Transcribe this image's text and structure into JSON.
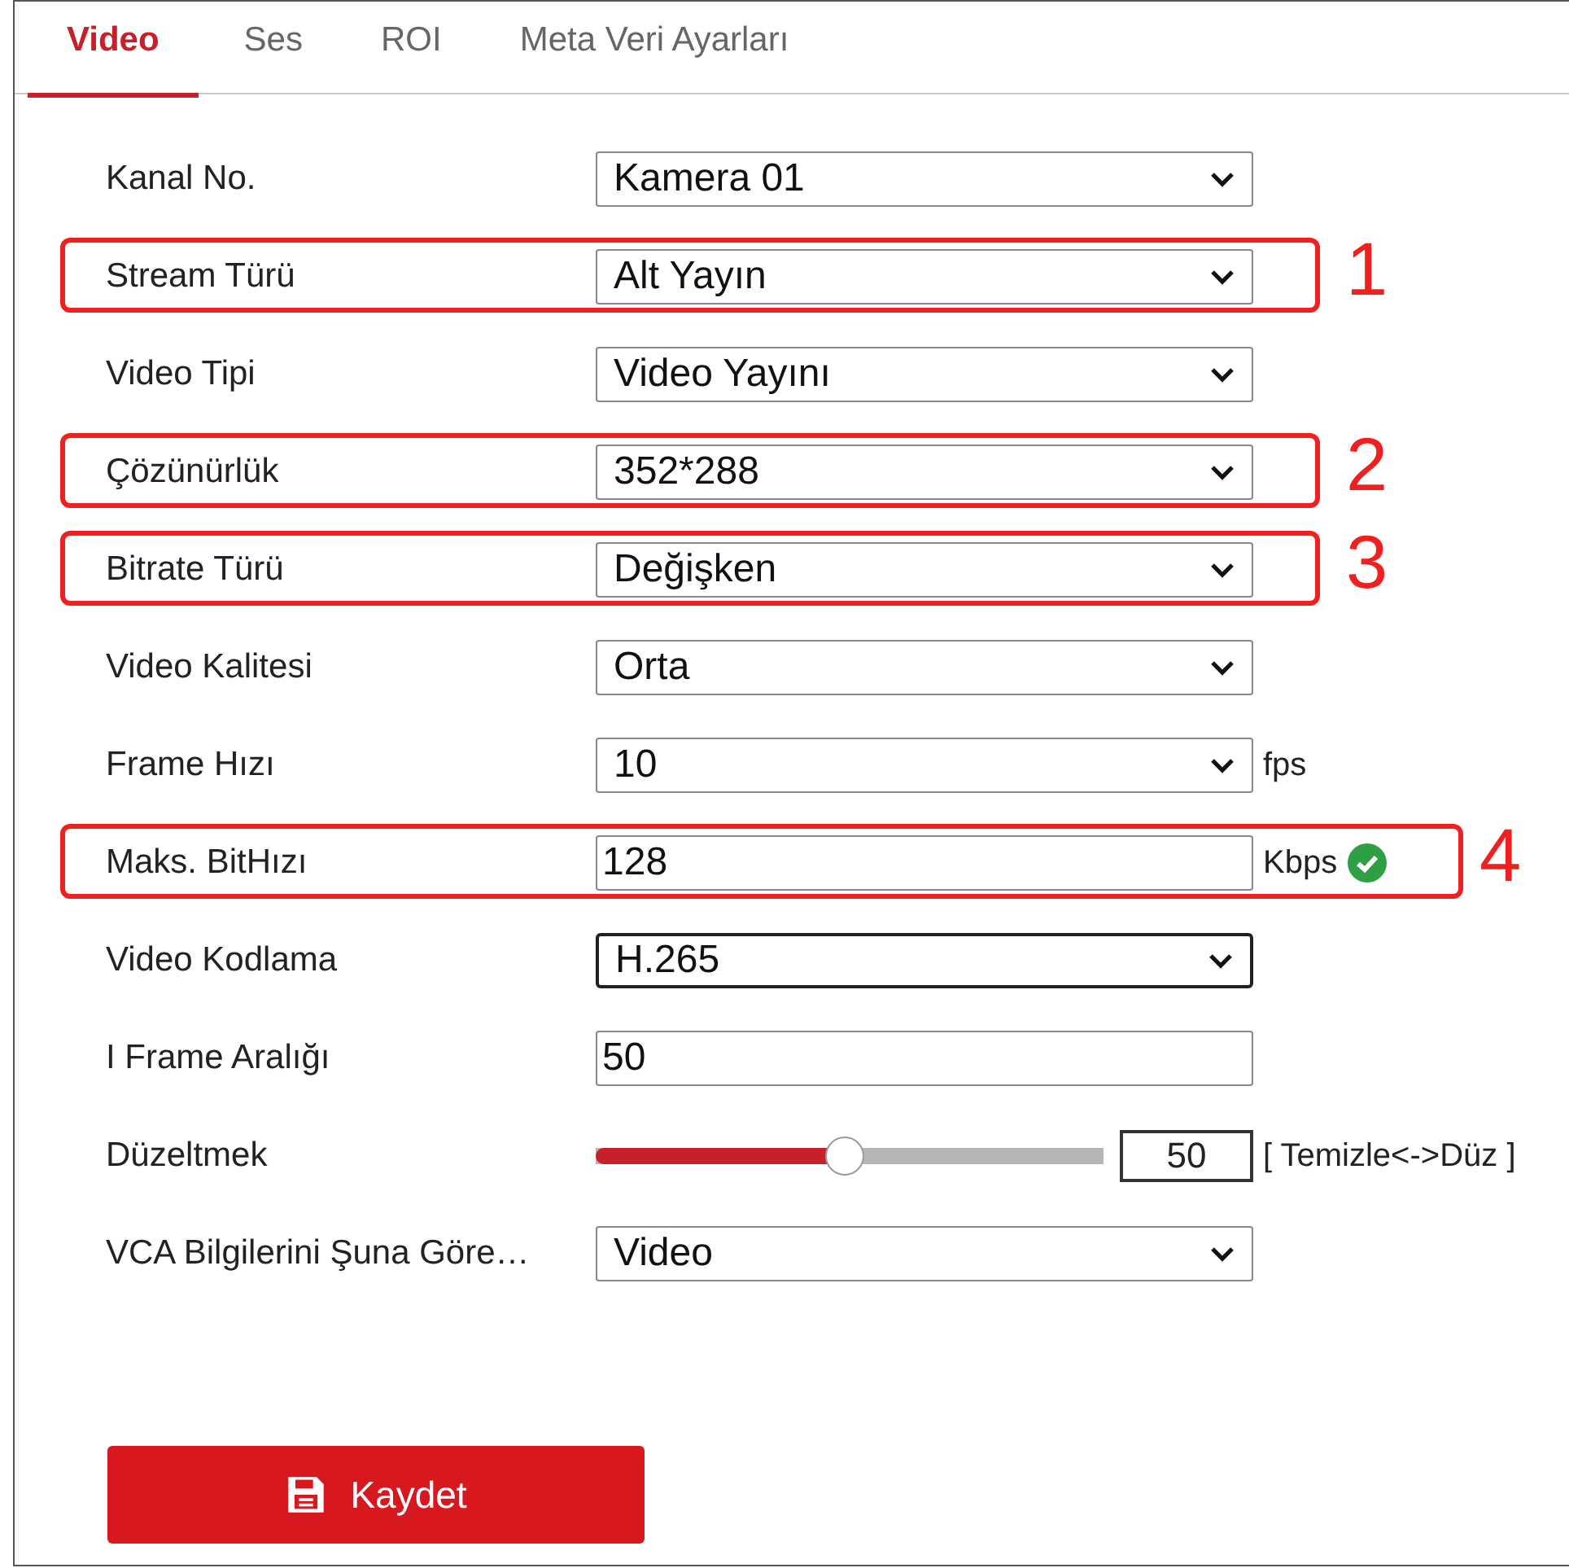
{
  "tabs": [
    {
      "label": "Video",
      "selected": true
    },
    {
      "label": "Ses",
      "selected": false
    },
    {
      "label": "ROI",
      "selected": false
    },
    {
      "label": "Meta Veri Ayarları",
      "selected": false
    }
  ],
  "rows": [
    {
      "kind": "select",
      "label": "Kanal No.",
      "value": "Kamera 01",
      "focused": false
    },
    {
      "kind": "select",
      "label": "Stream Türü",
      "value": "Alt Yayın",
      "focused": false,
      "highlight": "1"
    },
    {
      "kind": "select",
      "label": "Video Tipi",
      "value": "Video Yayını",
      "focused": false
    },
    {
      "kind": "select",
      "label": "Çözünürlük",
      "value": "352*288",
      "focused": false,
      "highlight": "2"
    },
    {
      "kind": "select",
      "label": "Bitrate Türü",
      "value": "Değişken",
      "focused": false,
      "highlight": "3"
    },
    {
      "kind": "select",
      "label": "Video Kalitesi",
      "value": "Orta",
      "focused": false
    },
    {
      "kind": "select",
      "label": "Frame Hızı",
      "value": "10",
      "focused": false,
      "unit": "fps"
    },
    {
      "kind": "input",
      "label": "Maks. BitHızı",
      "value": "128",
      "focused": false,
      "unit": "Kbps",
      "valid": true,
      "highlight": "4"
    },
    {
      "kind": "select",
      "label": "Video Kodlama",
      "value": "H.265",
      "focused": true
    },
    {
      "kind": "input",
      "label": "I Frame Aralığı",
      "value": "50",
      "focused": false
    },
    {
      "kind": "slider",
      "label": "Düzeltmek",
      "value": "50",
      "level": 0.49,
      "focused": false,
      "unit": "[ Temizle<->Düz ]"
    },
    {
      "kind": "select",
      "label": "VCA Bilgilerini Şuna Göre…",
      "value": "Video",
      "focused": false
    }
  ],
  "save_button": {
    "label": "Kaydet"
  }
}
